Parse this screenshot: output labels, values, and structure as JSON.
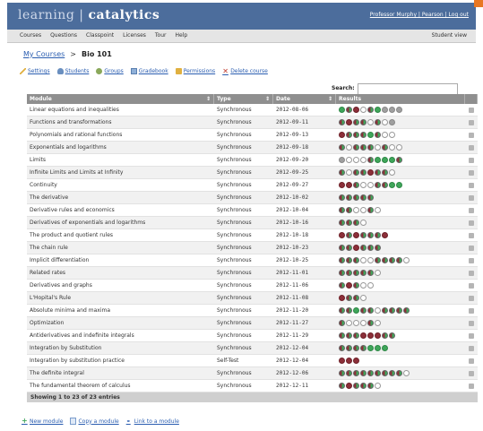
{
  "app": {
    "brand_left": "learning",
    "brand_sep": "|",
    "brand_right": "catalytics",
    "user_links": "Professor Murphy | Pearson | Log out"
  },
  "menu": [
    "Courses",
    "Questions",
    "Classpoint",
    "Licenses",
    "Tour",
    "Help"
  ],
  "student_view": "Student view",
  "breadcrumb": {
    "root": "My Courses",
    "sep": ">",
    "current": "Bio 101"
  },
  "actions": [
    {
      "label": "Settings",
      "icon": "pencil-icon"
    },
    {
      "label": "Students",
      "icon": "person-icon"
    },
    {
      "label": "Groups",
      "icon": "group-icon"
    },
    {
      "label": "Gradebook",
      "icon": "book-icon"
    },
    {
      "label": "Permissions",
      "icon": "lock-icon"
    },
    {
      "label": "Delete course",
      "icon": "x-icon"
    }
  ],
  "search": {
    "label": "Search:",
    "value": ""
  },
  "table": {
    "headers": [
      "Module",
      "Type",
      "Date",
      "Results",
      ""
    ],
    "rows": [
      {
        "module": "Linear equations and inequalities",
        "type": "Synchronous",
        "date": "2012-08-06",
        "dots": "ghrwhggy gy gy"
      },
      {
        "module": "Functions and transformations",
        "type": "Synchronous",
        "date": "2012-09-11",
        "dots": "hrhhwhwgy"
      },
      {
        "module": "Polynomials and rational functions",
        "type": "Synchronous",
        "date": "2012-09-13",
        "dots": "rhhhghww"
      },
      {
        "module": "Exponentials and logarithms",
        "type": "Synchronous",
        "date": "2012-09-18",
        "dots": "hwhhhwhww"
      },
      {
        "module": "Limits",
        "type": "Synchronous",
        "date": "2012-09-20",
        "dots": "gywwwhgggh"
      },
      {
        "module": "Infinite Limits and Limits at Infinity",
        "type": "Synchronous",
        "date": "2012-09-25",
        "dots": "hwhhrhhw"
      },
      {
        "module": "Continuity",
        "type": "Synchronous",
        "date": "2012-09-27",
        "dots": "rrhwwhhgg"
      },
      {
        "module": "The derivative",
        "type": "Synchronous",
        "date": "2012-10-02",
        "dots": "hhhhh"
      },
      {
        "module": "Derivative rules and economics",
        "type": "Synchronous",
        "date": "2012-10-04",
        "dots": "hhwwhw"
      },
      {
        "module": "Derivatives of exponentials and logarithms",
        "type": "Synchronous",
        "date": "2012-10-16",
        "dots": "hhhw"
      },
      {
        "module": "The product and quotient rules",
        "type": "Synchronous",
        "date": "2012-10-18",
        "dots": "rhrhhhr"
      },
      {
        "module": "The chain rule",
        "type": "Synchronous",
        "date": "2012-10-23",
        "dots": "hhrhhh"
      },
      {
        "module": "Implicit differentiation",
        "type": "Synchronous",
        "date": "2012-10-25",
        "dots": "hhhwwhhhhw"
      },
      {
        "module": "Related rates",
        "type": "Synchronous",
        "date": "2012-11-01",
        "dots": "hhhhhw"
      },
      {
        "module": "Derivatives and graphs",
        "type": "Synchronous",
        "date": "2012-11-06",
        "dots": "hrhww"
      },
      {
        "module": "L'Hopital's Rule",
        "type": "Synchronous",
        "date": "2012-11-08",
        "dots": "rhhw"
      },
      {
        "module": "Absolute minima and maxima",
        "type": "Synchronous",
        "date": "2012-11-20",
        "dots": "hhghhwhhhh"
      },
      {
        "module": "Optimization",
        "type": "Synchronous",
        "date": "2012-11-27",
        "dots": "hwwwhw"
      },
      {
        "module": "Antiderivatives and indefinite integrals",
        "type": "Synchronous",
        "date": "2012-11-29",
        "dots": "hhhrrrhh"
      },
      {
        "module": "Integration by Substitution",
        "type": "Synchronous",
        "date": "2012-12-04",
        "dots": "hhhhggg"
      },
      {
        "module": "Integration by substitution practice",
        "type": "Self-Test",
        "date": "2012-12-04",
        "dots": "rrr"
      },
      {
        "module": "The definite integral",
        "type": "Synchronous",
        "date": "2012-12-06",
        "dots": "hhhhhhhhhw"
      },
      {
        "module": "The fundamental theorem of calculus",
        "type": "Synchronous",
        "date": "2012-12-11",
        "dots": "hrhhhw"
      }
    ],
    "footer": "Showing 1 to 23 of 23 entries"
  },
  "bottom_actions": [
    {
      "label": "New module",
      "icon": "plus-icon"
    },
    {
      "label": "Copy a module",
      "icon": "copy-icon"
    },
    {
      "label": "Link to a module",
      "icon": "link-icon"
    }
  ],
  "colors": {
    "header_bar": "#4c6d9c",
    "dot_green": "#3fa65a",
    "dot_red": "#8c2f39",
    "accent_corner": "#e87722"
  }
}
